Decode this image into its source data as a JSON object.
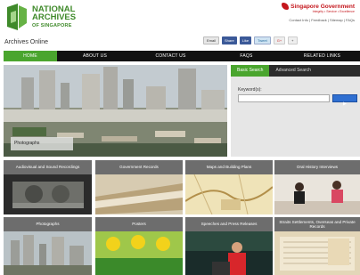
{
  "header": {
    "logo_line1": "NATIONAL",
    "logo_line2": "ARCHIVES",
    "logo_line3": "OF SINGAPORE",
    "gov_title": "Singapore Government",
    "gov_tagline": "Integrity • Service • Excellence",
    "gov_links": "Contact Info | Feedback | Sitemap | FAQs",
    "site_name": "Archives Online"
  },
  "toolbar": {
    "email_label": "Email",
    "share_label": "Share",
    "like_label": "Like",
    "tweet_label": "Tweet",
    "gplus_label": "G+",
    "plus_label": "+"
  },
  "nav": {
    "items": [
      "HOME",
      "ABOUT US",
      "CONTACT US",
      "FAQs",
      "RELATED LINKS"
    ]
  },
  "hero": {
    "caption": "Photographs"
  },
  "search": {
    "tab_basic": "Basic Search",
    "tab_advanced": "Advanced Search",
    "keyword_label": "Keyword(s):",
    "keyword_value": ""
  },
  "tiles": [
    {
      "title": "Audiovisual and Sound Recordings",
      "image": "film-reel"
    },
    {
      "title": "Government Records",
      "image": "documents"
    },
    {
      "title": "Maps and Building Plans",
      "image": "map"
    },
    {
      "title": "Oral History Interviews",
      "image": "interview"
    },
    {
      "title": "Photographs",
      "image": "skyline"
    },
    {
      "title": "Posters",
      "image": "poster"
    },
    {
      "title": "Speeches and Press Releases",
      "image": "speaker"
    },
    {
      "title": "Straits Settlements, Overseas and Private Records",
      "image": "ledger"
    }
  ],
  "colors": {
    "brand_green": "#4aa52e",
    "nav_black": "#111111",
    "tile_header": "#6d6d6d",
    "gov_red": "#c4161c"
  }
}
